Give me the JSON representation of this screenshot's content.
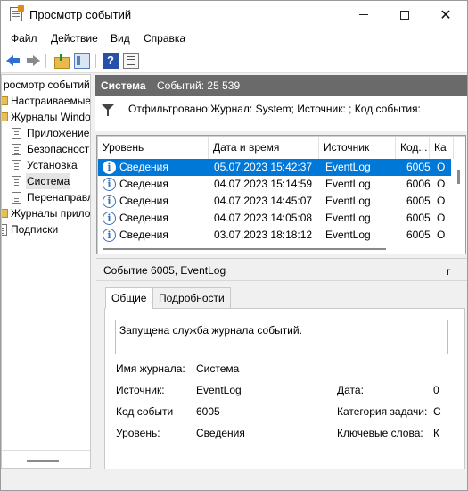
{
  "window": {
    "title": "Просмотр событий",
    "close_glyph": "✕"
  },
  "menu": [
    "Файл",
    "Действие",
    "Вид",
    "Справка"
  ],
  "tree": {
    "items": [
      {
        "label": "росмотр событий",
        "icon": "event-viewer-icon"
      },
      {
        "label": "Настраиваемые",
        "icon": "folder-icon"
      },
      {
        "label": "Журналы Windo",
        "icon": "folder-icon"
      },
      {
        "label": "Приложение",
        "icon": "log-icon"
      },
      {
        "label": "Безопасност",
        "icon": "log-icon"
      },
      {
        "label": "Установка",
        "icon": "log-icon"
      },
      {
        "label": "Система",
        "icon": "log-icon"
      },
      {
        "label": "Перенаправл",
        "icon": "log-icon"
      },
      {
        "label": "Журналы прило",
        "icon": "folder-icon"
      },
      {
        "label": "Подписки",
        "icon": "subscriptions-icon"
      }
    ]
  },
  "header": {
    "title": "Система",
    "count": "Событий: 25 539"
  },
  "filter": {
    "text": "Отфильтровано:Журнал: System; Источник: ; Код события:"
  },
  "events": {
    "columns": [
      "Уровень",
      "Дата и время",
      "Источник",
      "Код...",
      "Ка"
    ],
    "rows": [
      {
        "level": "Сведения",
        "datetime": "05.07.2023 15:42:37",
        "source": "EventLog",
        "code": "6005",
        "category": "О"
      },
      {
        "level": "Сведения",
        "datetime": "04.07.2023 15:14:59",
        "source": "EventLog",
        "code": "6006",
        "category": "О"
      },
      {
        "level": "Сведения",
        "datetime": "04.07.2023 14:45:07",
        "source": "EventLog",
        "code": "6005",
        "category": "О"
      },
      {
        "level": "Сведения",
        "datetime": "04.07.2023 14:05:08",
        "source": "EventLog",
        "code": "6005",
        "category": "О"
      },
      {
        "level": "Сведения",
        "datetime": "03.07.2023 18:18:12",
        "source": "EventLog",
        "code": "6005",
        "category": "О"
      }
    ],
    "info_glyph": "i"
  },
  "details": {
    "title": "Событие 6005, EventLog",
    "close_glyph": "r",
    "tabs": [
      "Общие",
      "Подробности"
    ],
    "message": "Запущена служба журнала событий.",
    "fields": {
      "log_name_label": "Имя журнала:",
      "log_name_value": "Система",
      "source_label": "Источник:",
      "source_value": "EventLog",
      "code_label": "Код событи",
      "code_value": "6005",
      "level_label": "Уровень:",
      "level_value": "Сведения",
      "date_label": "Дата:",
      "date_value": "0",
      "task_label": "Категория задачи:",
      "task_value": "С",
      "keywords_label": "Ключевые слова:",
      "keywords_value": "К"
    }
  },
  "toolbar": {
    "help_glyph": "?"
  }
}
